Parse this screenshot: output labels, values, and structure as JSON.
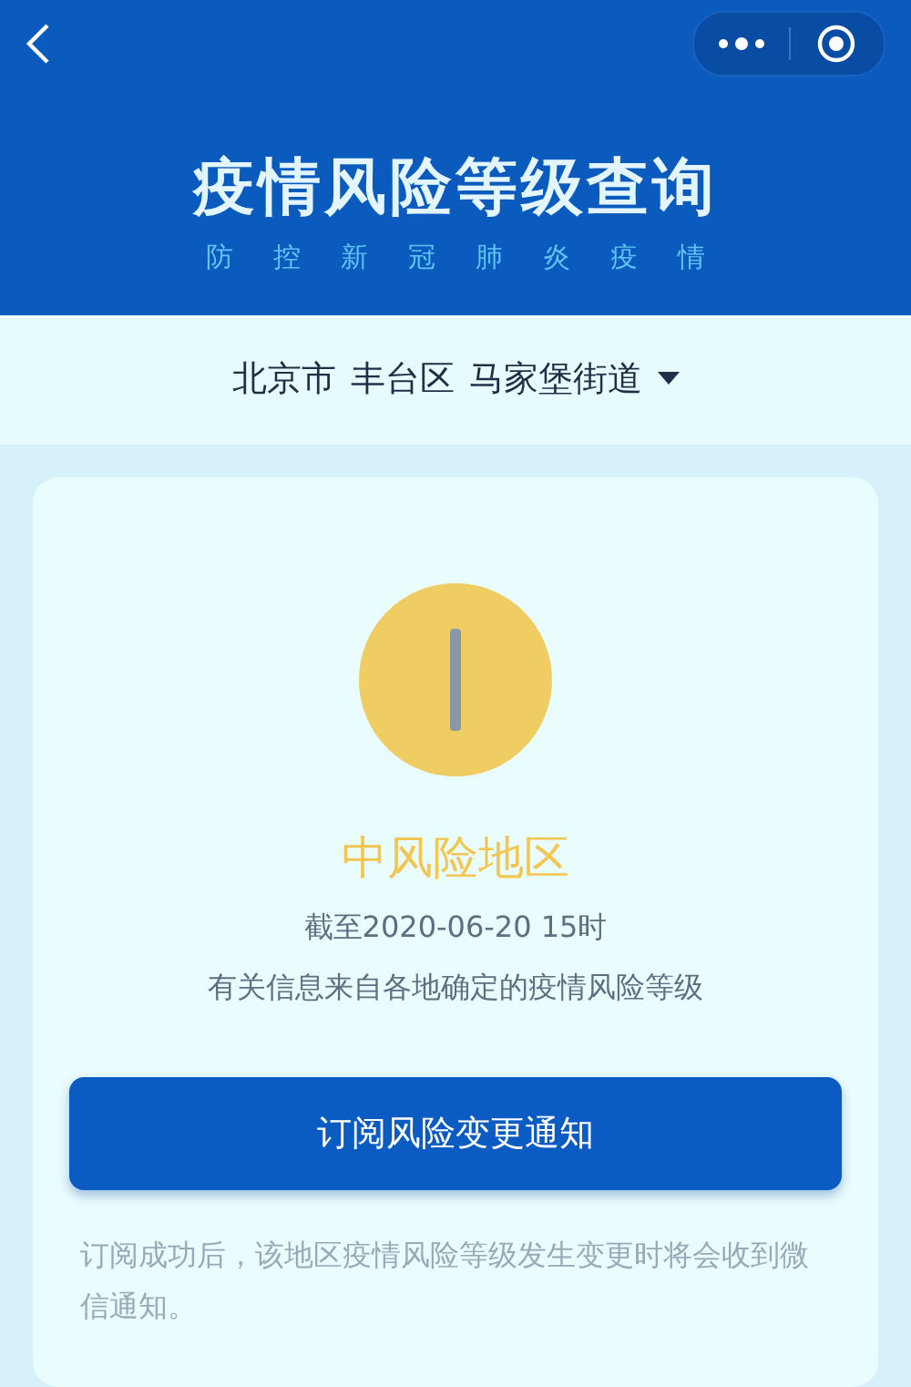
{
  "header": {
    "title": "疫情风险等级查询",
    "subtitle": "防控新冠肺炎疫情"
  },
  "location": {
    "city": "北京市",
    "district": "丰台区",
    "street": "马家堡街道"
  },
  "result": {
    "kind": "medium",
    "label": "中风险地区",
    "date": "截至2020-06-20 15时",
    "source": "有关信息来自各地确定的疫情风险等级"
  },
  "subscribe": {
    "button": "订阅风险变更通知",
    "note": "订阅成功后，该地区疫情风险等级发生变更时将会收到微信通知。"
  }
}
